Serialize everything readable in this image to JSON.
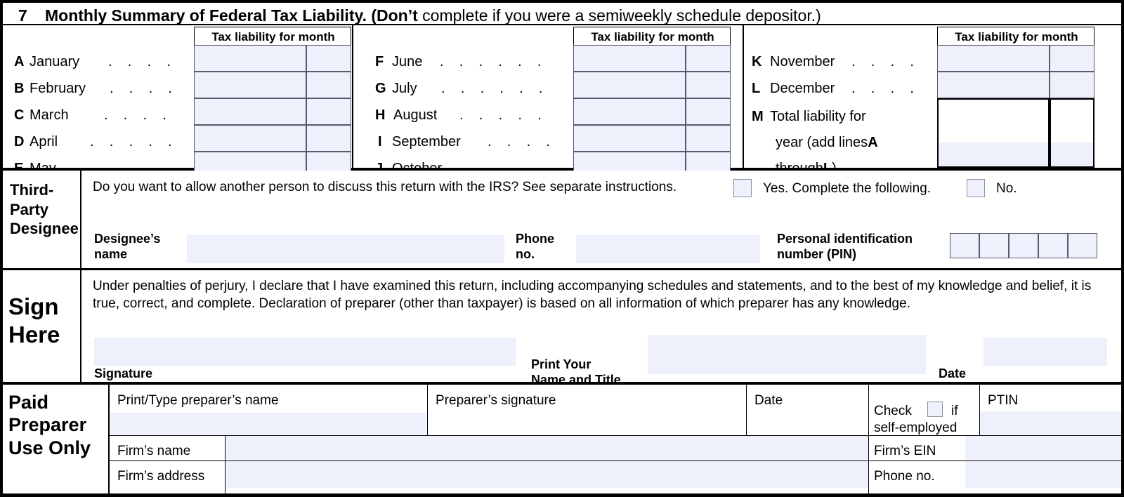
{
  "line7": {
    "number": "7",
    "title_bold_1": "Monthly Summary of Federal Tax Liability. (",
    "title_bold_2": "Don’t",
    "title_regular": " complete if you were a semiweekly schedule depositor.)"
  },
  "monthly_summary": {
    "column_header": "Tax liability for month",
    "column_headers": [
      "Tax liability for month",
      "Tax liability for month",
      "Tax liability for month"
    ],
    "dots": ".    .    .    .",
    "rows_col1": [
      {
        "letter": "A",
        "month": "January"
      },
      {
        "letter": "B",
        "month": "February"
      },
      {
        "letter": "C",
        "month": "March"
      },
      {
        "letter": "D",
        "month": "April"
      },
      {
        "letter": "E",
        "month": "May"
      }
    ],
    "rows_col2": [
      {
        "letter": "F",
        "month": "June"
      },
      {
        "letter": "G",
        "month": "July"
      },
      {
        "letter": "H",
        "month": "August"
      },
      {
        "letter": "I",
        "month": "September"
      },
      {
        "letter": "J",
        "month": "October"
      }
    ],
    "rows_col3": [
      {
        "letter": "K",
        "month": "November"
      },
      {
        "letter": "L",
        "month": "December"
      }
    ],
    "total_row": {
      "letter": "M",
      "line1": "Total liability for",
      "line2_pre": "year (add lines ",
      "line2_bold": "A",
      "line3_pre": "through ",
      "line3_bold": "L",
      "line3_post": ")."
    },
    "cell_values": {
      "A": "",
      "B": "",
      "C": "",
      "D": "",
      "E": "",
      "F": "",
      "G": "",
      "H": "",
      "I": "",
      "J": "",
      "K": "",
      "L": "",
      "M": ""
    }
  },
  "third_party": {
    "label_line1": "Third-",
    "label_line2": "Party",
    "label_line3": "Designee",
    "question": "Do you want to allow another person to discuss this return with the IRS? See separate instructions.",
    "yes_label": "Yes. Complete the following.",
    "no_label": "No.",
    "yes_checked": false,
    "no_checked": false,
    "designee_name_label_1": "Designee’s",
    "designee_name_label_2": "name",
    "designee_name_value": "",
    "phone_label_1": "Phone",
    "phone_label_2": "no.",
    "phone_value": "",
    "pin_label_1": "Personal identification",
    "pin_label_2": "number (PIN)",
    "pin_digits": [
      "",
      "",
      "",
      "",
      ""
    ]
  },
  "sign_here": {
    "label_line1": "Sign",
    "label_line2": "Here",
    "perjury_text": "Under penalties of perjury, I declare that I have examined this return, including accompanying schedules and statements, and to the best of my knowledge and belief, it is true, correct, and complete. Declaration of preparer (other than taxpayer) is based on all information of which preparer has any knowledge.",
    "signature_label": "Signature",
    "signature_value": "",
    "print_name_label_1": "Print Your",
    "print_name_label_2": "Name and Title",
    "print_name_value": "",
    "date_label": "Date",
    "date_value": ""
  },
  "paid_preparer": {
    "label_line1": "Paid",
    "label_line2": "Preparer",
    "label_line3": "Use Only",
    "preparer_name_label": "Print/Type preparer’s name",
    "preparer_name_value": "",
    "preparer_signature_label": "Preparer’s signature",
    "preparer_signature_value": "",
    "date_label": "Date",
    "date_value": "",
    "self_employed_label_1": "Check",
    "self_employed_label_2": "if",
    "self_employed_label_3": "self-employed",
    "self_employed_checked": false,
    "ptin_label": "PTIN",
    "ptin_value": "",
    "firm_name_label": "Firm’s name",
    "firm_name_value": "",
    "firm_address_label": "Firm’s address",
    "firm_address_value": "",
    "firm_ein_label": "Firm’s EIN",
    "firm_ein_value": "",
    "phone_label": "Phone no.",
    "phone_value": ""
  },
  "colors": {
    "field_fill": "#eef1fb",
    "field_border": "#55596a",
    "checkbox_border": "#8b8f9c",
    "rule": "#000000"
  }
}
